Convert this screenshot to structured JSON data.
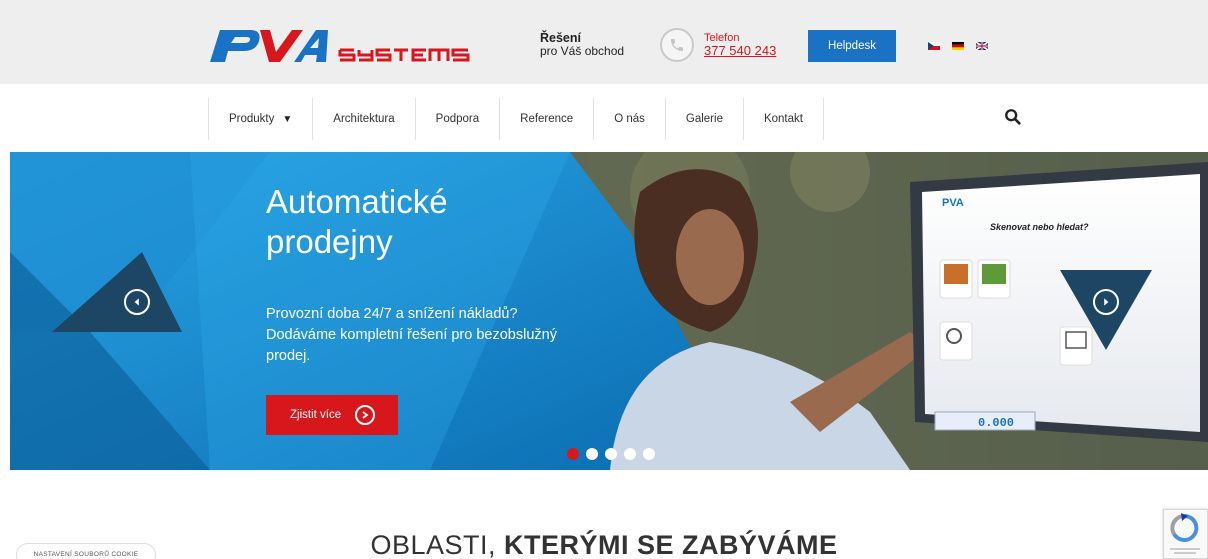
{
  "header": {
    "logo_text": "PVA SYSTEMS",
    "tagline_title": "Řešení",
    "tagline_sub": "pro Váš obchod",
    "phone_label": "Telefon",
    "phone_number": "377 540 243",
    "helpdesk_label": "Helpdesk",
    "flags": [
      "cz",
      "de",
      "en"
    ]
  },
  "nav": {
    "items": [
      "Produkty",
      "Architektura",
      "Podpora",
      "Reference",
      "O nás",
      "Galerie",
      "Kontakt"
    ],
    "caret": "▼"
  },
  "hero": {
    "title_line1": "Automatické",
    "title_line2": "prodejny",
    "text_line1": "Provozní doba 24/7 a snížení nákladů?",
    "text_line2": "Dodáváme kompletní řešení pro bezobslužný prodej.",
    "cta_label": "Zjistit více",
    "slides_count": 5,
    "active_slide": 1,
    "screen_heading": "Skenovat nebo hledat?",
    "screen_weight": "0.000"
  },
  "section": {
    "title_light": "OBLASTI,",
    "title_bold": "KTERÝMI SE ZABÝVÁME"
  },
  "cookie_label": "NASTAVENÍ SOUBORŮ COOKIE",
  "colors": {
    "brand_blue": "#1972c4",
    "brand_red": "#d8171d",
    "topbar_bg": "#eeeeee"
  }
}
